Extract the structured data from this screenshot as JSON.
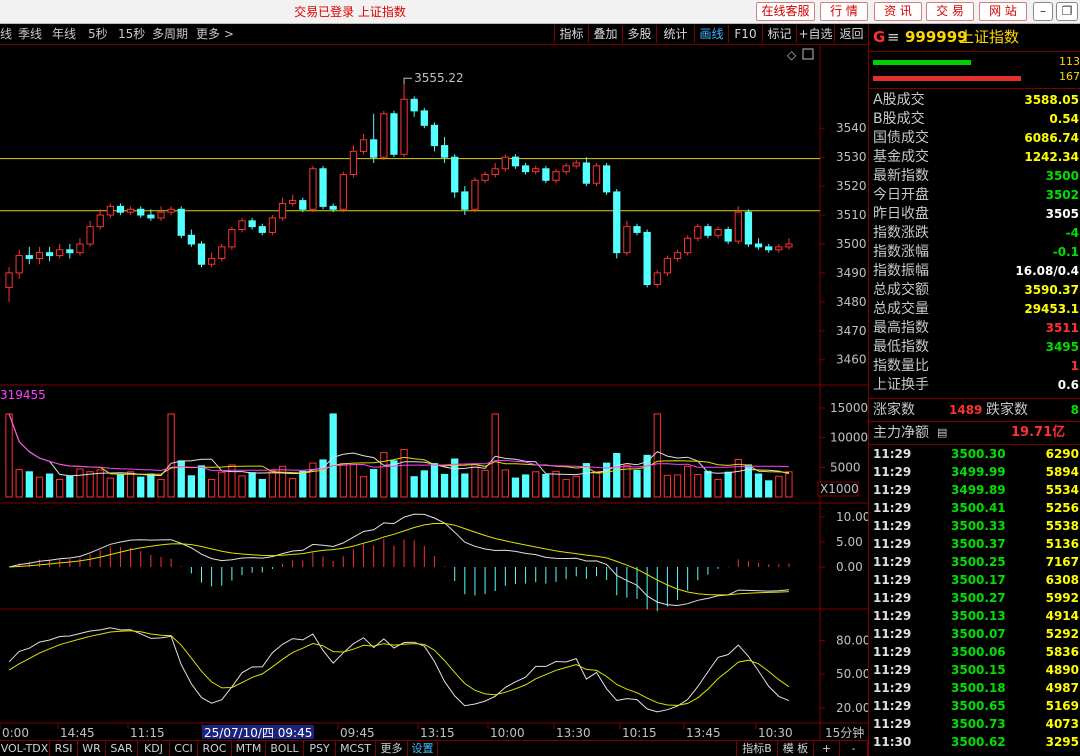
{
  "titlebar": {
    "title": "交易已登录  上证指数",
    "buttons": [
      "在线客服",
      "行 情",
      "资 讯",
      "交 易",
      "网 站"
    ]
  },
  "toolbar": {
    "periods": [
      "线",
      "季线",
      "年线",
      "5秒",
      "15秒",
      "多周期",
      "更多 >"
    ],
    "tools": [
      "指标",
      "叠加",
      "多股",
      "统计",
      "画线",
      "F10",
      "标记",
      "+自选",
      "返回"
    ],
    "active_tool": "画线"
  },
  "chart": {
    "price_axis": [
      "3540",
      "3530",
      "3520",
      "3510",
      "3500",
      "3490",
      "3480",
      "3470",
      "3460"
    ],
    "high_label": "3555.22",
    "vol_label": "319455",
    "vol_axis": [
      "15000",
      "10000",
      "5000"
    ],
    "vol_unit": "X1000",
    "macd_axis": [
      "10.00",
      "5.00",
      "0.00"
    ],
    "kdj_axis": [
      "80.00",
      "50.00",
      "20.00"
    ],
    "time_labels": [
      "0:00",
      "14:45",
      "11:15",
      "25/07/10/四 09:45",
      "09:45",
      "13:15",
      "10:00",
      "13:30",
      "10:15",
      "13:45",
      "10:30"
    ],
    "period": "15分钟"
  },
  "chart_data": {
    "type": "candlestick",
    "upper_line": 3529.5,
    "lower_line": 3511.5,
    "ylim": [
      3453,
      3566
    ],
    "high": 3555.22,
    "candles": [
      [
        3485,
        3490,
        3480,
        3492
      ],
      [
        3490,
        3496,
        3488,
        3498
      ],
      [
        3496,
        3495,
        3493,
        3499
      ],
      [
        3495,
        3497,
        3493,
        3499
      ],
      [
        3497,
        3496,
        3494,
        3499
      ],
      [
        3496,
        3498,
        3495,
        3500
      ],
      [
        3498,
        3497,
        3495,
        3500
      ],
      [
        3497,
        3500,
        3496,
        3502
      ],
      [
        3500,
        3506,
        3499,
        3508
      ],
      [
        3506,
        3510,
        3505,
        3512
      ],
      [
        3510,
        3513,
        3509,
        3514
      ],
      [
        3513,
        3511,
        3510,
        3514
      ],
      [
        3511,
        3512,
        3510,
        3513
      ],
      [
        3512,
        3510,
        3509,
        3513
      ],
      [
        3510,
        3509,
        3508,
        3512
      ],
      [
        3509,
        3511,
        3508,
        3513
      ],
      [
        3511,
        3512,
        3510,
        3513
      ],
      [
        3512,
        3503,
        3502,
        3513
      ],
      [
        3503,
        3500,
        3499,
        3505
      ],
      [
        3500,
        3493,
        3492,
        3501
      ],
      [
        3493,
        3495,
        3492,
        3497
      ],
      [
        3495,
        3499,
        3494,
        3500
      ],
      [
        3499,
        3505,
        3498,
        3506
      ],
      [
        3505,
        3508,
        3504,
        3509
      ],
      [
        3508,
        3506,
        3505,
        3509
      ],
      [
        3506,
        3504,
        3503,
        3507
      ],
      [
        3504,
        3509,
        3503,
        3510
      ],
      [
        3509,
        3514,
        3508,
        3516
      ],
      [
        3514,
        3515,
        3513,
        3517
      ],
      [
        3515,
        3512,
        3511,
        3516
      ],
      [
        3512,
        3526,
        3511,
        3527
      ],
      [
        3526,
        3513,
        3512,
        3527
      ],
      [
        3513,
        3512,
        3511,
        3514
      ],
      [
        3512,
        3524,
        3511,
        3525
      ],
      [
        3524,
        3532,
        3523,
        3534
      ],
      [
        3532,
        3536,
        3531,
        3538
      ],
      [
        3536,
        3530,
        3528,
        3545
      ],
      [
        3530,
        3545,
        3529,
        3546
      ],
      [
        3545,
        3531,
        3530,
        3546
      ],
      [
        3531,
        3550,
        3530,
        3555.22
      ],
      [
        3550,
        3546,
        3544,
        3551
      ],
      [
        3546,
        3541,
        3540,
        3547
      ],
      [
        3541,
        3534,
        3532,
        3542
      ],
      [
        3534,
        3530,
        3528,
        3537
      ],
      [
        3530,
        3518,
        3516,
        3531
      ],
      [
        3518,
        3512,
        3510,
        3520
      ],
      [
        3512,
        3522,
        3511,
        3523
      ],
      [
        3522,
        3524,
        3521,
        3525
      ],
      [
        3524,
        3526,
        3523,
        3528
      ],
      [
        3526,
        3530,
        3525,
        3531
      ],
      [
        3530,
        3527,
        3526,
        3531
      ],
      [
        3527,
        3525,
        3524,
        3528
      ],
      [
        3525,
        3526,
        3524,
        3527
      ],
      [
        3526,
        3522,
        3521,
        3527
      ],
      [
        3522,
        3525,
        3521,
        3526
      ],
      [
        3525,
        3527,
        3524,
        3528
      ],
      [
        3527,
        3528,
        3526,
        3529
      ],
      [
        3528,
        3521,
        3520,
        3530
      ],
      [
        3521,
        3527,
        3520,
        3528
      ],
      [
        3527,
        3518,
        3517,
        3528
      ],
      [
        3518,
        3497,
        3495,
        3519
      ],
      [
        3497,
        3506,
        3496,
        3508
      ],
      [
        3506,
        3504,
        3503,
        3507
      ],
      [
        3504,
        3486,
        3485,
        3505
      ],
      [
        3486,
        3490,
        3485,
        3491
      ],
      [
        3490,
        3495,
        3489,
        3496
      ],
      [
        3495,
        3497,
        3494,
        3498
      ],
      [
        3497,
        3502,
        3496,
        3503
      ],
      [
        3502,
        3506,
        3501,
        3507
      ],
      [
        3506,
        3503,
        3502,
        3507
      ],
      [
        3503,
        3505,
        3502,
        3506
      ],
      [
        3505,
        3501,
        3500,
        3506
      ],
      [
        3501,
        3511,
        3500,
        3513
      ],
      [
        3511,
        3500,
        3499,
        3512
      ],
      [
        3500,
        3499,
        3498,
        3502
      ],
      [
        3499,
        3498,
        3497,
        3500
      ],
      [
        3498,
        3499,
        3497,
        3500
      ],
      [
        3499,
        3500,
        3498,
        3502
      ]
    ]
  },
  "quote": {
    "header_g": "G",
    "code": "999999",
    "name": "上证指数",
    "bar_top_val": "113",
    "bar_bot_val": "167",
    "rows": [
      {
        "label": "A股成交",
        "value": "3588.05",
        "color": "#ffff00"
      },
      {
        "label": "B股成交",
        "value": "0.54",
        "color": "#ffff00"
      },
      {
        "label": "国债成交",
        "value": "6086.74",
        "color": "#ffff00"
      },
      {
        "label": "基金成交",
        "value": "1242.34",
        "color": "#ffff00"
      },
      {
        "label": "最新指数",
        "value": "3500",
        "color": "#00e000"
      },
      {
        "label": "今日开盘",
        "value": "3502",
        "color": "#00e000"
      },
      {
        "label": "昨日收盘",
        "value": "3505",
        "color": "#ffffff"
      },
      {
        "label": "指数涨跌",
        "value": "-4",
        "color": "#00e000"
      },
      {
        "label": "指数涨幅",
        "value": "-0.1",
        "color": "#00e000"
      },
      {
        "label": "指数振幅",
        "value": "16.08/0.4",
        "color": "#ffffff"
      },
      {
        "label": "总成交额",
        "value": "3590.37",
        "color": "#ffff00"
      },
      {
        "label": "总成交量",
        "value": "29453.1",
        "color": "#ffff00"
      },
      {
        "label": "最高指数",
        "value": "3511",
        "color": "#ff3030"
      },
      {
        "label": "最低指数",
        "value": "3495",
        "color": "#00e000"
      },
      {
        "label": "指数量比",
        "value": "1",
        "color": "#ff3030"
      },
      {
        "label": "上证换手",
        "value": "0.6",
        "color": "#ffffff"
      }
    ],
    "rise_label": "涨家数",
    "rise_value": "1489",
    "fall_label": "跌家数",
    "fall_value": "8",
    "main_label": "主力净额",
    "main_value": "19.71亿",
    "ticks": [
      {
        "time": "11:29",
        "price": "3500.30",
        "vol": "6290"
      },
      {
        "time": "11:29",
        "price": "3499.99",
        "vol": "5894"
      },
      {
        "time": "11:29",
        "price": "3499.89",
        "vol": "5534"
      },
      {
        "time": "11:29",
        "price": "3500.41",
        "vol": "5256"
      },
      {
        "time": "11:29",
        "price": "3500.33",
        "vol": "5538"
      },
      {
        "time": "11:29",
        "price": "3500.37",
        "vol": "5136"
      },
      {
        "time": "11:29",
        "price": "3500.25",
        "vol": "7167"
      },
      {
        "time": "11:29",
        "price": "3500.17",
        "vol": "6308"
      },
      {
        "time": "11:29",
        "price": "3500.27",
        "vol": "5992"
      },
      {
        "time": "11:29",
        "price": "3500.13",
        "vol": "4914"
      },
      {
        "time": "11:29",
        "price": "3500.07",
        "vol": "5292"
      },
      {
        "time": "11:29",
        "price": "3500.06",
        "vol": "5836"
      },
      {
        "time": "11:29",
        "price": "3500.15",
        "vol": "4890"
      },
      {
        "time": "11:29",
        "price": "3500.18",
        "vol": "4987"
      },
      {
        "time": "11:29",
        "price": "3500.65",
        "vol": "5169"
      },
      {
        "time": "11:29",
        "price": "3500.73",
        "vol": "4073"
      },
      {
        "time": "11:30",
        "price": "3500.62",
        "vol": "3295"
      }
    ]
  },
  "bottom_tabs": [
    "VOL-TDX",
    "RSI",
    "WR",
    "SAR",
    "KDJ",
    "CCI",
    "ROC",
    "MTM",
    "BOLL",
    "PSY",
    "MCST",
    "更多",
    "设置"
  ],
  "bottom_right": [
    "指标B",
    "模 板",
    "+",
    "-"
  ],
  "colors": {
    "up": "#ff3030",
    "down": "#54ffff",
    "ma1": "#e0e0e0",
    "ma2": "#e0e000",
    "ma3": "#ff40ff",
    "level": "#e0d000",
    "grid": "#800000"
  }
}
